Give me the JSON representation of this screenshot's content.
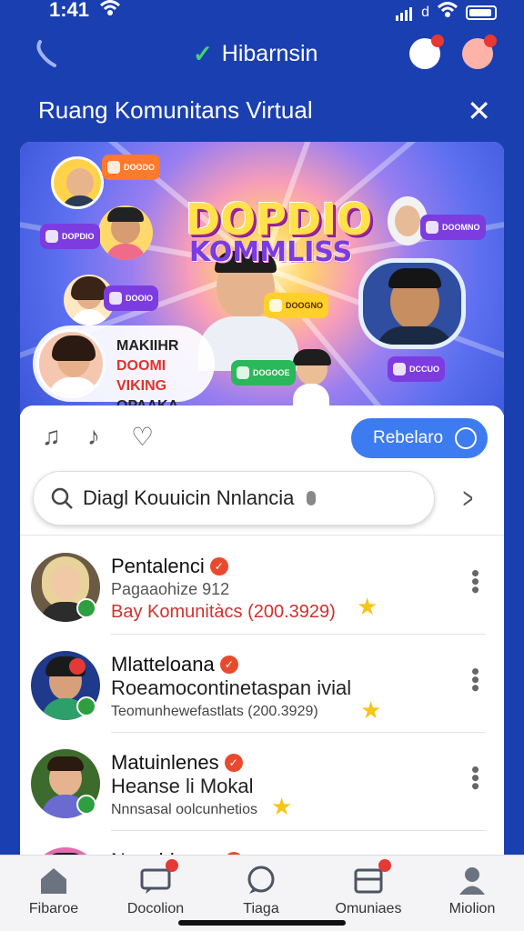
{
  "status": {
    "time": "1:41",
    "carrier_letter": "d"
  },
  "appbar": {
    "title": "Hibarnsin"
  },
  "room": {
    "title": "Ruang Komunitans Virtual"
  },
  "banner": {
    "headline": "DOPDIO",
    "headline2": "KOMMLISS",
    "tag_line1": "MAKIIHR",
    "tag_line2": "DOOMI VIKING",
    "tag_line3": "OPAAKA",
    "pills": [
      "DOODO",
      "DOPDIO",
      "DOOIO",
      "DOOGNO",
      "DOOMNO",
      "DOGOOE",
      "DCCUO"
    ]
  },
  "toolbar": {
    "primary_label": "Rebelaro"
  },
  "search": {
    "value": "Diagl Kouuicin Nnlancia"
  },
  "list": [
    {
      "name": "Pentalenci",
      "subtitle": "Pagaaohize 912",
      "meta": "Bay Komunitàcs (200.3929)"
    },
    {
      "name": "Mlatteloana",
      "subtitle": "Roeamocontinetaspan ivial",
      "meta": "Teomunhewefastlats (200.3929)"
    },
    {
      "name": "Matuinlenes",
      "subtitle": "Heanse li Mokal",
      "meta": "Nnnsasal oolcunhetios"
    },
    {
      "name": "Nenoblaana",
      "subtitle": "",
      "meta": ""
    }
  ],
  "nav": [
    {
      "label": "Fibaroe"
    },
    {
      "label": "Docolion"
    },
    {
      "label": "Tiaga"
    },
    {
      "label": "Omuniaes"
    },
    {
      "label": "Miolion"
    }
  ],
  "colors": {
    "brand": "#1a3fb0",
    "primary_button": "#3d7bf0",
    "verified": "#e84a2e",
    "online": "#2e9e3f",
    "meta_red": "#d0312d"
  }
}
